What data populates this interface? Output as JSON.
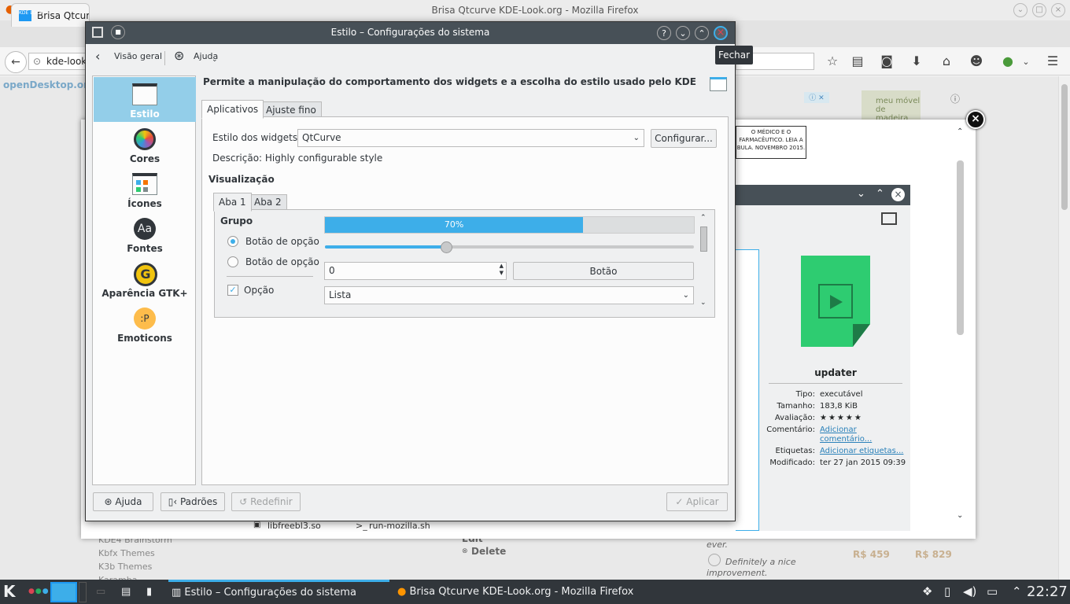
{
  "firefox": {
    "window_title": "Brisa Qtcurve KDE-Look.org - Mozilla Firefox",
    "tab_title": "Brisa Qtcurve",
    "tab_favicon": "KDE\nLOOK",
    "url": "kde-look.",
    "site_brand": "openDesktop.or",
    "side_links": [
      "KDE4 Brainstorm",
      "Kbfx Themes",
      "K3b Themes",
      "Karamba"
    ],
    "page_actions": [
      "Edit",
      "Delete"
    ],
    "comment_snippets": [
      "ever.",
      "Definitely a nice",
      "improvement."
    ],
    "prices": [
      "R$ 459",
      "R$ 829"
    ],
    "ad_text": "O MÉDICO E O FARMACÊUTICO. LEIA A BULA. NOVEMBRO 2015.",
    "ad2_text": "meu móvel de madeira",
    "files": [
      "libfreebl3.so",
      "run-mozilla.sh"
    ]
  },
  "dolphin": {
    "file_name": "updater",
    "props": [
      {
        "k": "Tipo:",
        "v": "executável",
        "link": false
      },
      {
        "k": "Tamanho:",
        "v": "183,8 KiB",
        "link": false
      },
      {
        "k": "Avaliação:",
        "v": "★★★★★",
        "link": false
      },
      {
        "k": "Comentário:",
        "v": "Adicionar comentário...",
        "link": true
      },
      {
        "k": "Etiquetas:",
        "v": "Adicionar etiquetas...",
        "link": true
      },
      {
        "k": "Modificado:",
        "v": "ter 27 jan 2015 09:39",
        "link": false
      }
    ]
  },
  "dialog": {
    "title": "Estilo – Configurações do sistema",
    "tooltip": "Fechar",
    "toolbar": {
      "back": "Visão geral",
      "help": "Ajuda"
    },
    "sidebar": [
      {
        "label": "Estilo",
        "icon": "window-icon",
        "selected": true
      },
      {
        "label": "Cores",
        "icon": "color-wheel-icon",
        "selected": false
      },
      {
        "label": "Ícones",
        "icon": "icons-icon",
        "selected": false
      },
      {
        "label": "Fontes",
        "icon": "font-icon",
        "selected": false
      },
      {
        "label": "Aparência GTK+",
        "icon": "gtk-icon",
        "selected": false
      },
      {
        "label": "Emoticons",
        "icon": "emoticon-icon",
        "selected": false
      }
    ],
    "description": "Permite a manipulação do comportamento dos widgets e a escolha do estilo usado pelo KDE",
    "tabs": [
      "Aplicativos",
      "Ajuste fino"
    ],
    "widget_style_label": "Estilo dos widgets:",
    "widget_style_value": "QtCurve",
    "configure_button": "Configurar...",
    "style_description": "Descrição: Highly configurable style",
    "preview_heading": "Visualização",
    "preview_tabs": [
      "Aba 1",
      "Aba 2"
    ],
    "preview": {
      "group_label": "Grupo",
      "radio1": "Botão de opção",
      "radio2": "Botão de opção",
      "checkbox": "Opção",
      "progress": 70,
      "progress_text": "70%",
      "slider": 0.33,
      "spin_value": "0",
      "button": "Botão",
      "list": "Lista"
    },
    "buttons": {
      "help": "Ajuda",
      "defaults": "Padrões",
      "reset": "Redefinir",
      "apply": "Aplicar"
    }
  },
  "panel": {
    "tasks": [
      "Estilo – Configurações do sistema",
      "Brisa Qtcurve KDE-Look.org - Mozilla Firefox"
    ],
    "clock": "22:27"
  }
}
